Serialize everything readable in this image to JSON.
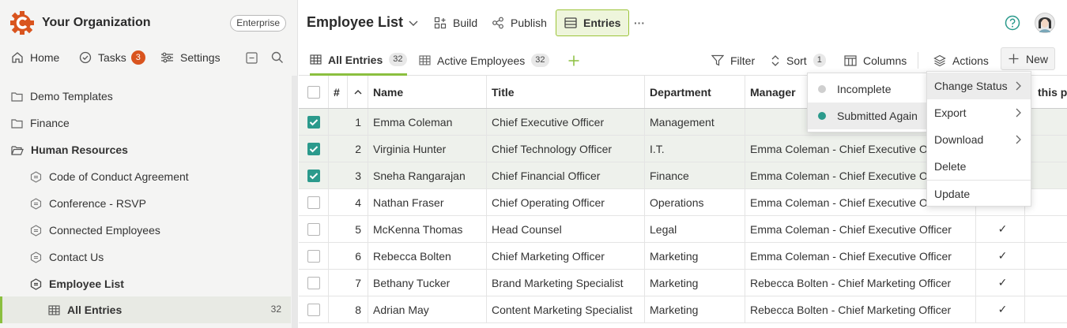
{
  "org": {
    "name": "Your Organization",
    "plan": "Enterprise"
  },
  "nav": {
    "home": "Home",
    "tasks": "Tasks",
    "tasks_count": "3",
    "settings": "Settings"
  },
  "tree": {
    "folders": [
      "Demo Templates",
      "Finance",
      "Human Resources"
    ],
    "forms": [
      "Code of Conduct Agreement",
      "Conference - RSVP",
      "Connected Employees",
      "Contact Us",
      "Employee List"
    ],
    "active_view": "All Entries",
    "active_count": "32"
  },
  "header": {
    "title": "Employee List",
    "build": "Build",
    "publish": "Publish",
    "entries": "Entries",
    "more": "···"
  },
  "tabs": [
    {
      "label": "All Entries",
      "count": "32"
    },
    {
      "label": "Active Employees",
      "count": "32"
    }
  ],
  "toolbar": {
    "filter": "Filter",
    "sort": "Sort",
    "sort_count": "1",
    "columns": "Columns",
    "actions": "Actions",
    "new": "New"
  },
  "grid": {
    "columns": [
      "#",
      "Name",
      "Title",
      "Department",
      "Manager",
      "this p"
    ],
    "rows": [
      {
        "n": "1",
        "name": "Emma Coleman",
        "title": "Chief Executive Officer",
        "dept": "Management",
        "manager": "",
        "checked": true,
        "flag": ""
      },
      {
        "n": "2",
        "name": "Virginia Hunter",
        "title": "Chief Technology Officer",
        "dept": "I.T.",
        "manager": "Emma Coleman - Chief Executive Officer",
        "checked": true,
        "flag": ""
      },
      {
        "n": "3",
        "name": "Sneha Rangarajan",
        "title": "Chief Financial Officer",
        "dept": "Finance",
        "manager": "Emma Coleman - Chief Executive Officer",
        "checked": true,
        "flag": ""
      },
      {
        "n": "4",
        "name": "Nathan Fraser",
        "title": "Chief Operating Officer",
        "dept": "Operations",
        "manager": "Emma Coleman - Chief Executive Officer",
        "checked": false,
        "flag": ""
      },
      {
        "n": "5",
        "name": "McKenna Thomas",
        "title": "Head Counsel",
        "dept": "Legal",
        "manager": "Emma Coleman - Chief Executive Officer",
        "checked": false,
        "flag": "✓"
      },
      {
        "n": "6",
        "name": "Rebecca Bolten",
        "title": "Chief Marketing Officer",
        "dept": "Marketing",
        "manager": "Emma Coleman - Chief Executive Officer",
        "checked": false,
        "flag": "✓"
      },
      {
        "n": "7",
        "name": "Bethany Tucker",
        "title": "Brand Marketing Specialist",
        "dept": "Marketing",
        "manager": "Rebecca Bolten - Chief Marketing Officer",
        "checked": false,
        "flag": "✓"
      },
      {
        "n": "8",
        "name": "Adrian May",
        "title": "Content Marketing Specialist",
        "dept": "Marketing",
        "manager": "Rebecca Bolten - Chief Marketing Officer",
        "checked": false,
        "flag": "✓"
      }
    ]
  },
  "actions_menu": [
    "Change Status",
    "Export",
    "Download",
    "Delete",
    "Update"
  ],
  "status_menu": [
    {
      "label": "Incomplete",
      "color": "#cfcfcf"
    },
    {
      "label": "Submitted Again",
      "color": "#2b9a8c"
    }
  ],
  "colors": {
    "accent": "#8bbf3f",
    "teal": "#2b9a8c",
    "logo": "#d9541e"
  }
}
